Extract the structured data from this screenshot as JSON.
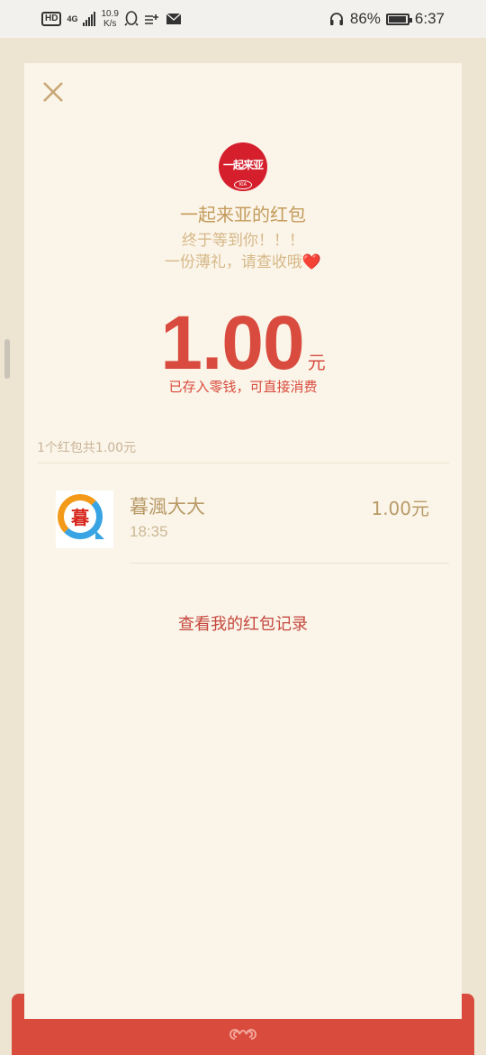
{
  "status_bar": {
    "hd": "HD",
    "network": "4G",
    "speed_value": "10.9",
    "speed_unit": "K/s",
    "battery": "86%",
    "time": "6:37"
  },
  "packet": {
    "sender": "一起来亚的红包",
    "logo_text": "一起来亚",
    "logo_sub": "KIA",
    "greeting_line1": "终于等到你！！！",
    "greeting_line2": "一份薄礼，请查收哦",
    "heart": "❤️",
    "amount": "1.00",
    "unit": "元",
    "stored_note": "已存入零钱，可直接消费"
  },
  "summary": "1个红包共1.00元",
  "receivers": [
    {
      "name": "暮渢大大",
      "time": "18:35",
      "amount": "1.00元",
      "avatar_char": "暮"
    }
  ],
  "history_link": "查看我的红包记录",
  "colors": {
    "accent_red": "#d84b3e",
    "gold_text": "#c49b5c",
    "card_bg": "#fbf5e9",
    "page_bg": "#ede4d2"
  }
}
